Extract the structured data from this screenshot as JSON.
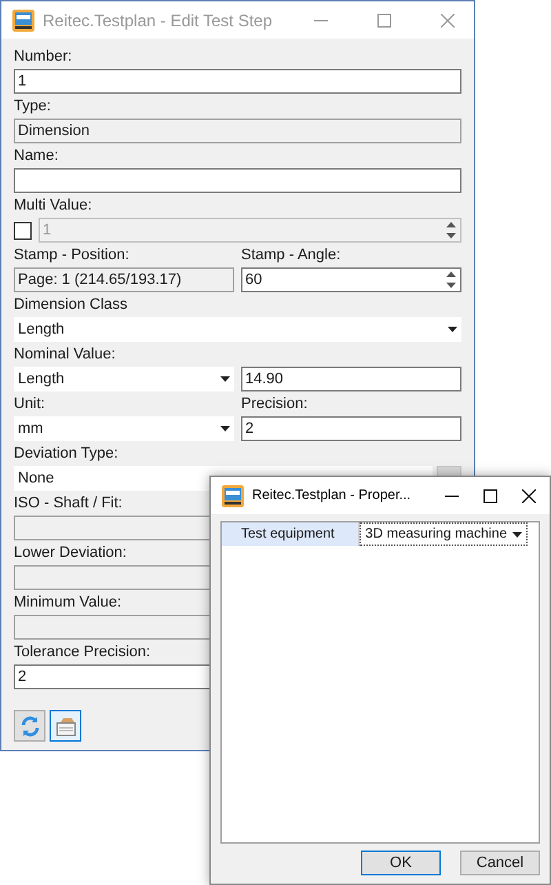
{
  "main_window": {
    "title": "Reitec.Testplan - Edit Test Step",
    "blocks": [
      {
        "columns": [
          {
            "label": "Number:",
            "control": {
              "kind": "text",
              "value": "1"
            }
          }
        ]
      },
      {
        "columns": [
          {
            "label": "Type:",
            "control": {
              "kind": "readonly",
              "value": "Dimension"
            }
          }
        ]
      },
      {
        "columns": [
          {
            "label": "Name:",
            "control": {
              "kind": "text"
            }
          }
        ]
      },
      {
        "columns": [
          {
            "label": "Multi Value:",
            "control": {
              "kind": "checkbox-spin",
              "checked": false,
              "value": "1"
            }
          }
        ]
      },
      {
        "columns": [
          {
            "label": "Stamp - Position:",
            "control": {
              "kind": "readonly",
              "value": "Page: 1 (214.65/193.17)"
            }
          },
          {
            "label": "Stamp - Angle:",
            "control": {
              "kind": "spin",
              "value": "60"
            }
          }
        ]
      },
      {
        "columns": [
          {
            "label": "Dimension Class",
            "control": {
              "kind": "dropdown",
              "value": "Length"
            }
          }
        ]
      },
      {
        "columns": [
          {
            "label": "Nominal Value:",
            "control": {
              "kind": "dropdown",
              "value": "Length"
            }
          },
          {
            "control": {
              "kind": "text",
              "value": "14.90"
            }
          }
        ]
      },
      {
        "columns": [
          {
            "label": "Unit:",
            "control": {
              "kind": "dropdown",
              "value": "mm"
            }
          },
          {
            "label": "Precision:",
            "control": {
              "kind": "text",
              "value": "2"
            }
          }
        ]
      },
      {
        "columns": [
          {
            "label": "Deviation Type:",
            "control": {
              "kind": "dropdown-button",
              "value": "None"
            }
          }
        ]
      },
      {
        "columns": [
          {
            "label": "ISO - Shaft / Fit:",
            "control": {
              "kind": "readonly"
            }
          }
        ]
      },
      {
        "columns": [
          {
            "label": "Lower Deviation:",
            "control": {
              "kind": "readonly"
            }
          }
        ]
      },
      {
        "columns": [
          {
            "label": "Minimum Value:",
            "control": {
              "kind": "readonly"
            }
          }
        ]
      },
      {
        "columns": [
          {
            "label": "Tolerance Precision:",
            "control": {
              "kind": "text",
              "value": "2"
            }
          }
        ]
      }
    ],
    "toolbar": [
      {
        "kind": "refresh",
        "selected": false
      },
      {
        "kind": "properties",
        "selected": true
      }
    ]
  },
  "dialog": {
    "title": "Reitec.Testplan - Proper...",
    "properties": [
      {
        "name": "Test equipment",
        "value": "3D measuring machine",
        "selected": true
      }
    ],
    "buttons": [
      {
        "label": "OK",
        "default": true
      },
      {
        "label": "Cancel",
        "default": false
      }
    ]
  }
}
